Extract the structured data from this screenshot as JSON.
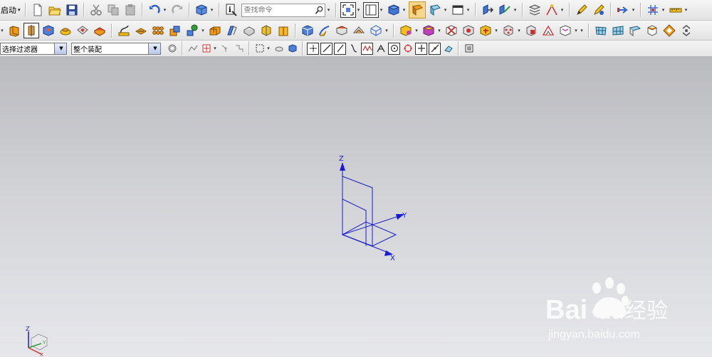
{
  "toolbar_top": {
    "start_label": "启动",
    "search_placeholder": "查找命令"
  },
  "toolbar_selection": {
    "filter_value": "选择过滤器",
    "scope_value": "整个装配"
  },
  "viewport": {
    "axis_labels": {
      "z": "Z",
      "y": "Y",
      "x": "X"
    },
    "triad_labels": {
      "z": "Z",
      "y": "Y",
      "x": "X"
    }
  },
  "watermark": {
    "brand": "Bai",
    "brand2": "du",
    "cn": "经验",
    "url": "jingyan.baidu.com"
  },
  "colors": {
    "axis_blue": "#1a1ad8",
    "accent_orange": "#f09a1c"
  },
  "icons_row1": [
    "new-file-icon",
    "open-folder-icon",
    "save-icon",
    "cut-icon",
    "copy-icon",
    "paste-icon",
    "undo-icon",
    "redo-icon",
    "cube-view-icon",
    "info-icon",
    "search-icon",
    "fit-view-icon",
    "layout-icon",
    "shaded-cube-icon",
    "face-highlight-icon",
    "face-edge-icon",
    "window-icon",
    "point-snap-icon",
    "measure-icon",
    "layers-icon",
    "sketch-icon",
    "pencil-icon",
    "arrow-icon",
    "grid-icon",
    "ruler-icon"
  ]
}
